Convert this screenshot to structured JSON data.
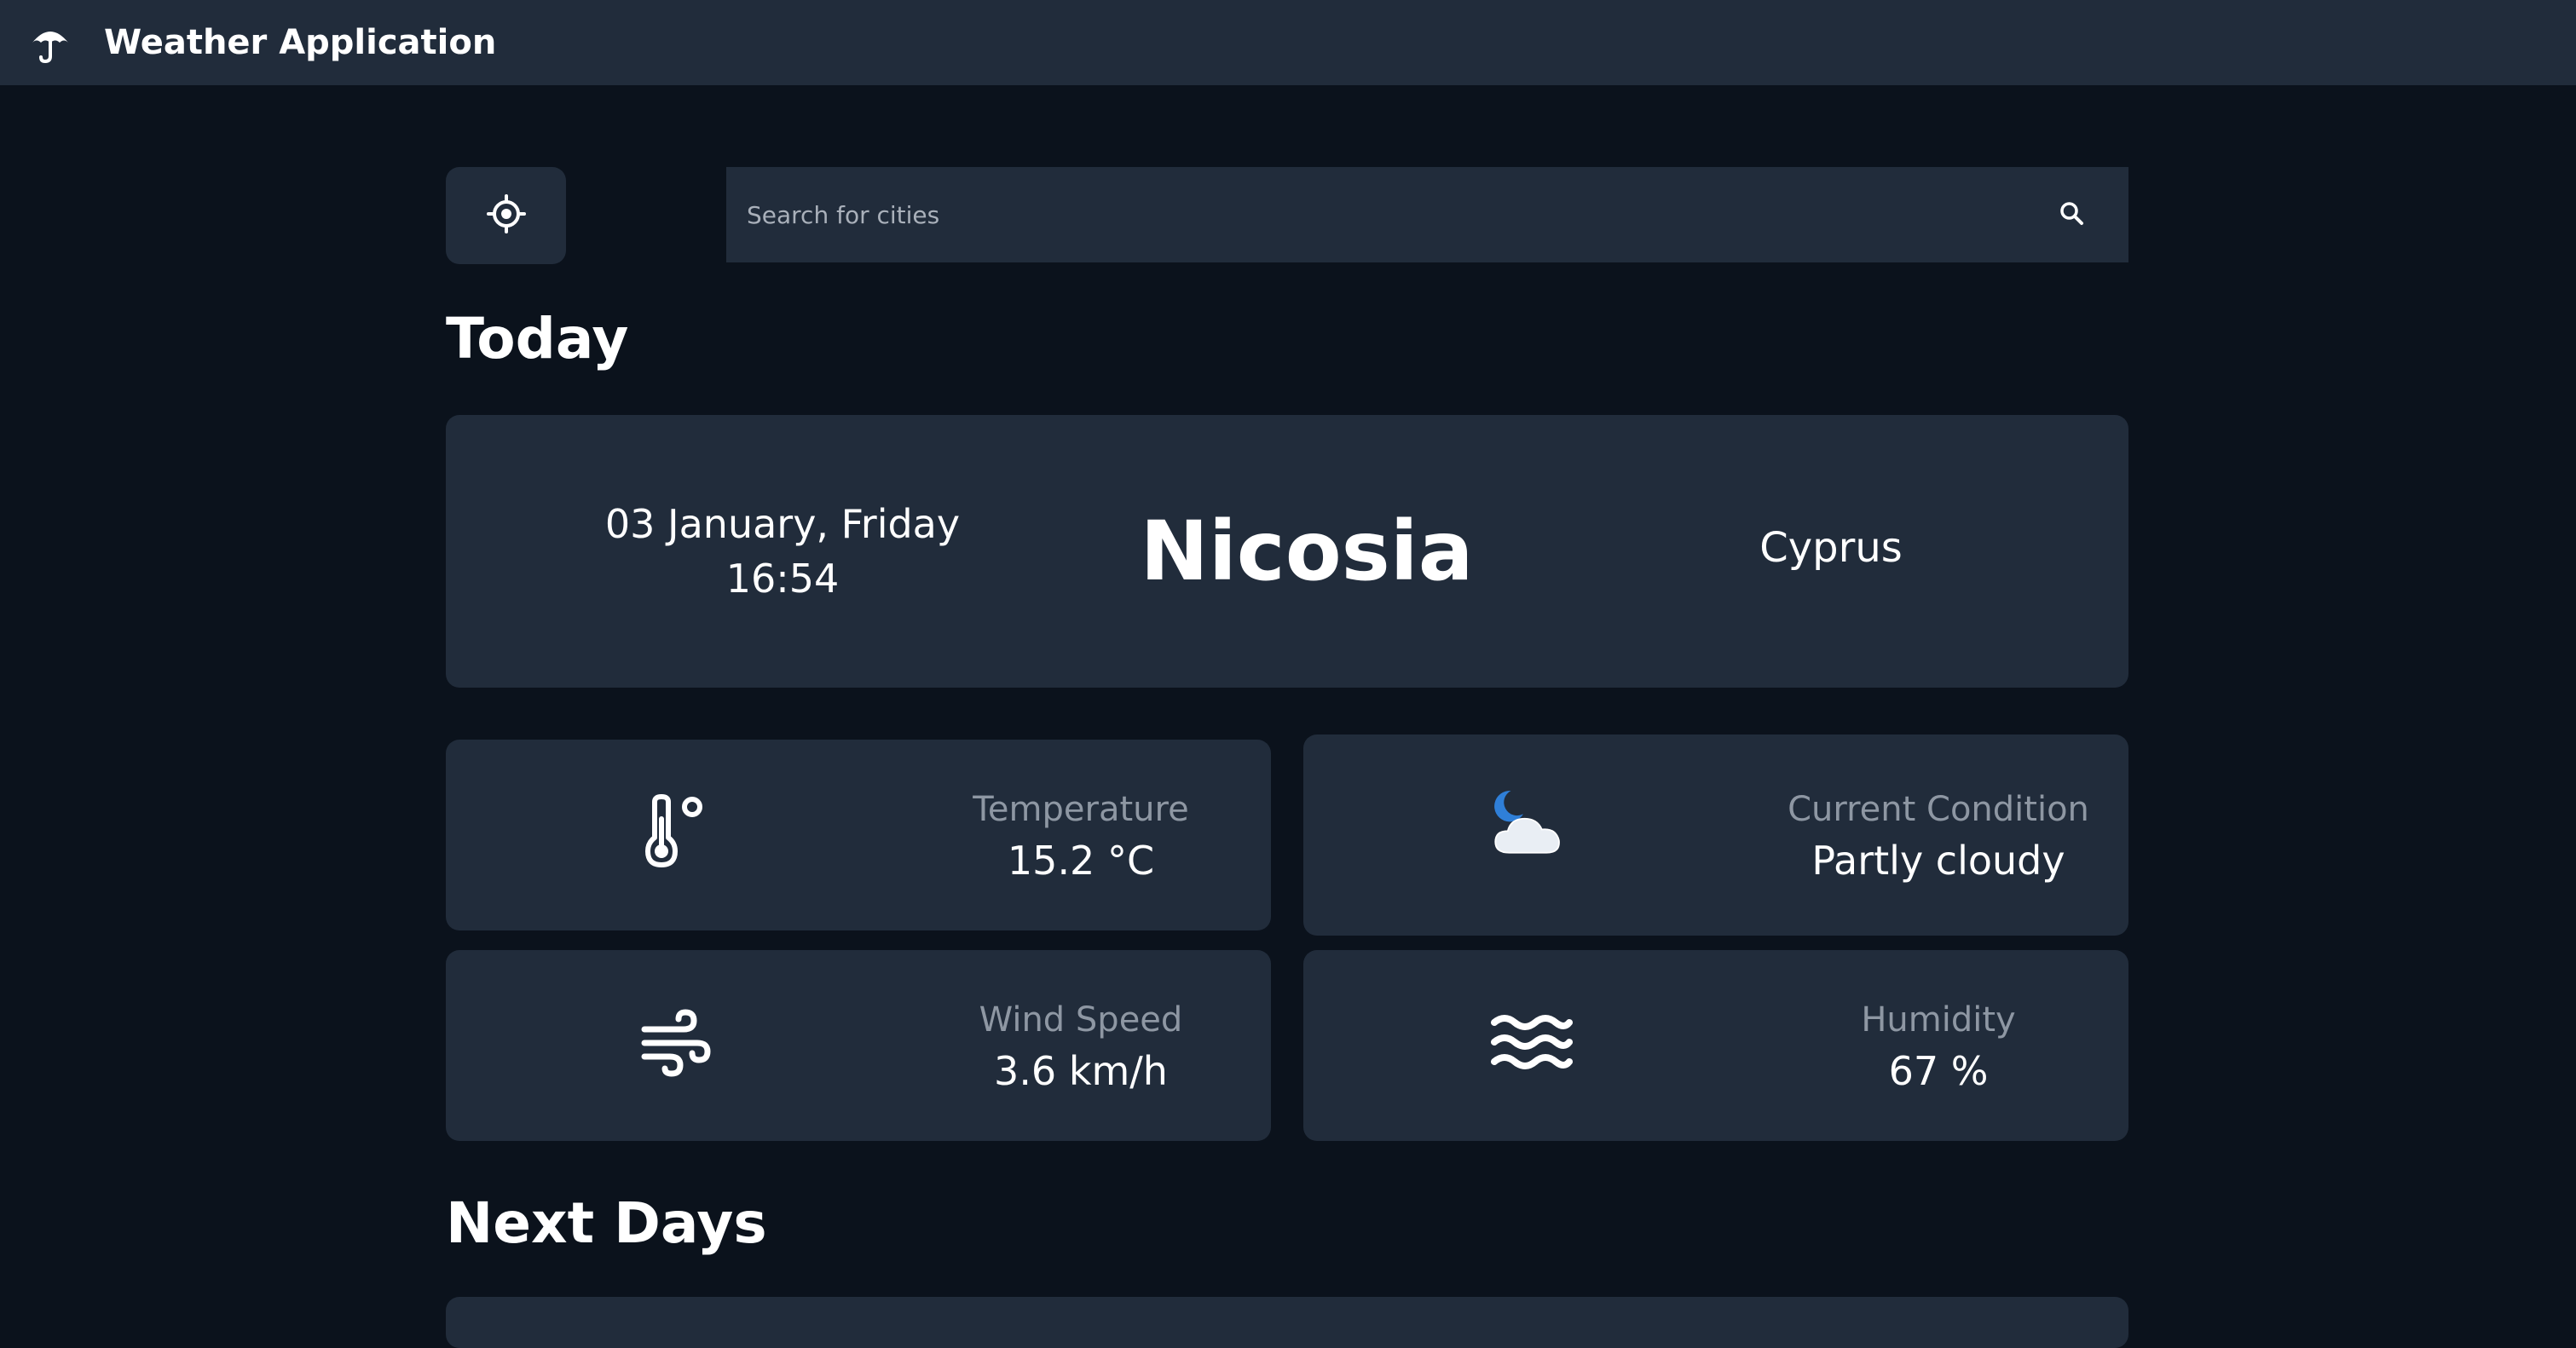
{
  "header": {
    "title": "Weather Application",
    "logo_icon": "umbrella-icon"
  },
  "search": {
    "placeholder": "Search for cities",
    "value": "",
    "locate_icon": "location-crosshair-icon",
    "search_icon": "search-icon"
  },
  "today": {
    "section_title": "Today",
    "date": "03 January, Friday",
    "time": "16:54",
    "city": "Nicosia",
    "country": "Cyprus"
  },
  "stats": {
    "temperature": {
      "label": "Temperature",
      "value": "15.2 °C",
      "icon": "thermometer-icon"
    },
    "condition": {
      "label": "Current Condition",
      "value": "Partly cloudy",
      "icon": "moon-cloud-icon"
    },
    "wind": {
      "label": "Wind Speed",
      "value": "3.6 km/h",
      "icon": "wind-icon"
    },
    "humidity": {
      "label": "Humidity",
      "value": "67 %",
      "icon": "water-waves-icon"
    }
  },
  "next_days": {
    "section_title": "Next Days"
  },
  "colors": {
    "background": "#0b121c",
    "surface": "#212c3b",
    "muted_text": "#8e97a3",
    "accent_moon": "#2f7fd8"
  }
}
